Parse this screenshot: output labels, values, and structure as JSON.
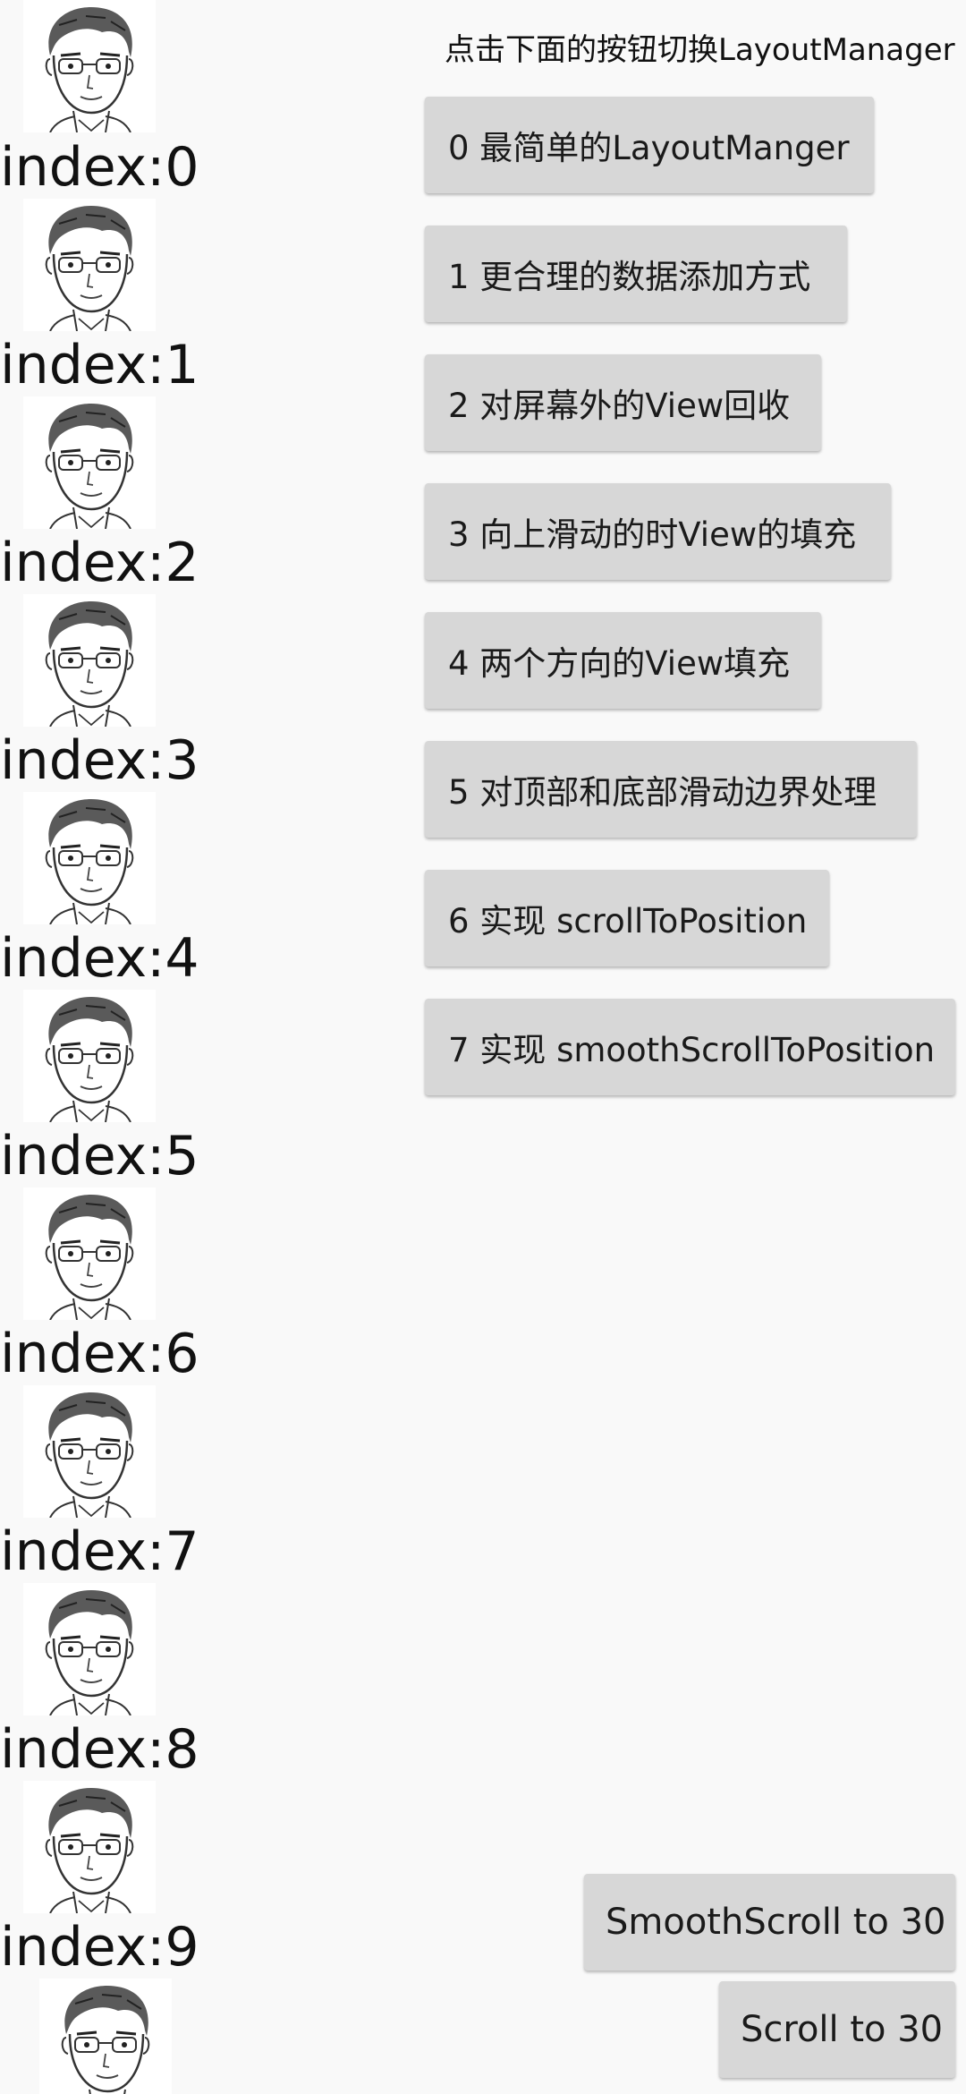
{
  "list": {
    "items": [
      {
        "label": "index:0"
      },
      {
        "label": "index:1"
      },
      {
        "label": "index:2"
      },
      {
        "label": "index:3"
      },
      {
        "label": "index:4"
      },
      {
        "label": "index:5"
      },
      {
        "label": "index:6"
      },
      {
        "label": "index:7"
      },
      {
        "label": "index:8"
      },
      {
        "label": "index:9"
      }
    ]
  },
  "panel": {
    "hint": "点击下面的按钮切换LayoutManager",
    "buttons": [
      {
        "label": "0 最简单的LayoutManger"
      },
      {
        "label": "1 更合理的数据添加方式"
      },
      {
        "label": "2 对屏幕外的View回收"
      },
      {
        "label": "3 向上滑动的时View的填充"
      },
      {
        "label": "4 两个方向的View填充"
      },
      {
        "label": "5 对顶部和底部滑动边界处理"
      },
      {
        "label": "6 实现 scrollToPosition"
      },
      {
        "label": "7 实现 smoothScrollToPosition"
      }
    ]
  },
  "actions": {
    "smooth_scroll": "SmoothScroll to 30",
    "scroll": "Scroll to 30"
  }
}
